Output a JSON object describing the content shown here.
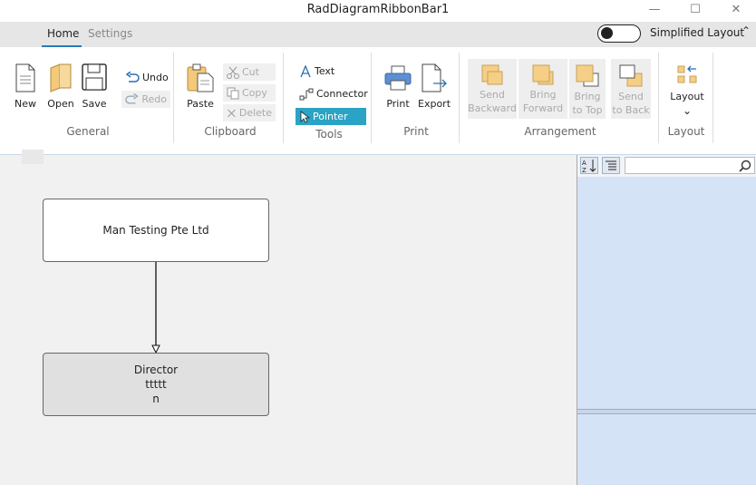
{
  "window": {
    "title": "RadDiagramRibbonBar1"
  },
  "tabs": [
    {
      "label": "Home"
    },
    {
      "label": "Settings"
    }
  ],
  "simplified_layout": {
    "label": "Simplified Layout",
    "on": false
  },
  "groups": {
    "general": {
      "label": "General",
      "new": "New",
      "open": "Open",
      "save": "Save",
      "undo": "Undo",
      "redo": "Redo"
    },
    "clipboard": {
      "label": "Clipboard",
      "paste": "Paste",
      "cut": "Cut",
      "copy": "Copy",
      "delete": "Delete"
    },
    "tools": {
      "label": "Tools",
      "text": "Text",
      "connector": "Connector",
      "pointer": "Pointer"
    },
    "print": {
      "label": "Print",
      "print": "Print",
      "export": "Export"
    },
    "arrangement": {
      "label": "Arrangement",
      "send_backward": [
        "Send",
        "Backward"
      ],
      "bring_forward": [
        "Bring",
        "Forward"
      ],
      "bring_to_top": [
        "Bring",
        "to Top"
      ],
      "send_to_back": [
        "Send",
        "to Back"
      ]
    },
    "layout": {
      "label": "Layout",
      "layout": "Layout"
    }
  },
  "diagram": {
    "node1": {
      "text": "Man Testing Pte Ltd"
    },
    "node2": {
      "line1": "Director",
      "line2": "ttttt",
      "line3": "n"
    }
  },
  "colors": {
    "accent": "#2a7ab8",
    "pointer_active": "#2ba3c4",
    "panel_bg": "#d5e3f7",
    "arrange_icon": "#f5cf86"
  }
}
